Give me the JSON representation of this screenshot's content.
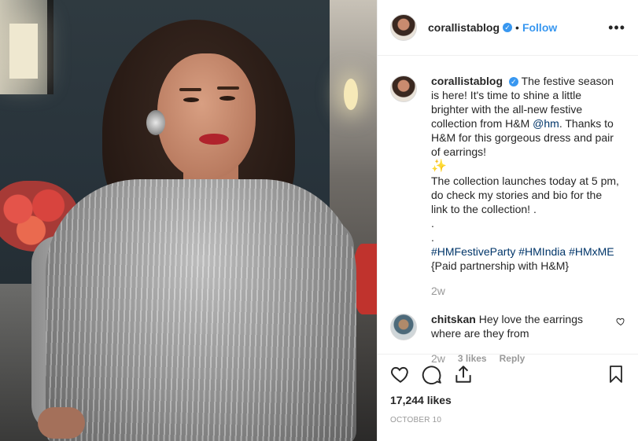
{
  "post": {
    "username": "corallistablog",
    "follow_label": "Follow",
    "separator": "•",
    "more_label": "•••",
    "caption": {
      "text": "The festive season is here! It's time to shine a little brighter with the all-new festive collection from H&M",
      "mention": "@hm",
      "text2": ". Thanks to H&M for this gorgeous dress and pair of earrings!",
      "sparkle": "✨",
      "text3": "The collection launches today at 5 pm, do check my stories and bio for the link to the collection! .\n.\n.",
      "hashtags": [
        "#HMFestiveParty",
        "#HMIndia",
        "#HMxME"
      ],
      "footer": "{Paid partnership with H&M}",
      "time": "2w"
    },
    "comments": [
      {
        "username": "chitskan",
        "text": "Hey love the earrings where are they from",
        "time": "2w",
        "likes": "3 likes",
        "reply": "Reply"
      }
    ],
    "like_count": "17,244 likes",
    "date": "OCTOBER 10"
  },
  "icons": {
    "verified": "verified-badge-icon",
    "heart": "heart-icon",
    "comment": "comment-icon",
    "share": "share-icon",
    "bookmark": "bookmark-icon"
  },
  "colors": {
    "link": "#3897f0",
    "hashtag": "#003569",
    "muted": "#999999",
    "text": "#262626"
  }
}
